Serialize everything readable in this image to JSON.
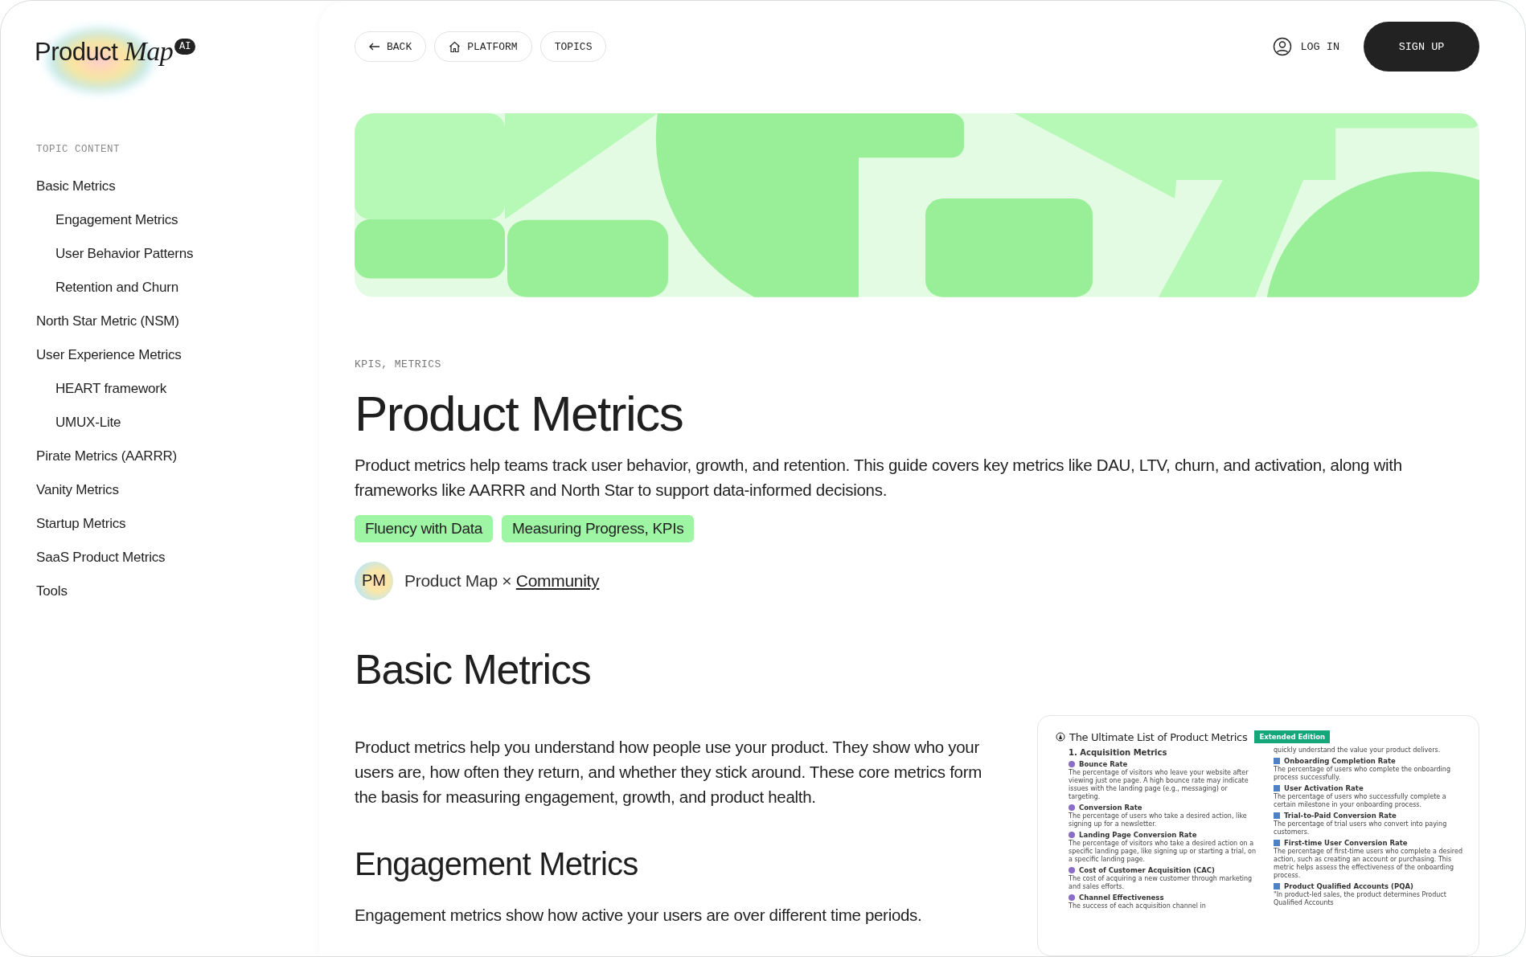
{
  "logo": {
    "text": "Product",
    "emphasis": "Map",
    "badge": "AI"
  },
  "nav": [
    {
      "label": "BACK",
      "kind": "back"
    },
    {
      "label": "PLATFORM",
      "kind": "home"
    },
    {
      "label": "TOPICS",
      "kind": "plain"
    }
  ],
  "auth": {
    "login": "LOG IN",
    "signup": "SIGN UP"
  },
  "sidebar": {
    "heading": "TOPIC CONTENT",
    "items": [
      {
        "label": "Basic Metrics",
        "children": [
          {
            "label": "Engagement Metrics"
          },
          {
            "label": "User Behavior Patterns"
          },
          {
            "label": "Retention and Churn"
          }
        ]
      },
      {
        "label": "North Star Metric (NSM)"
      },
      {
        "label": "User Experience Metrics",
        "children": [
          {
            "label": "HEART framework"
          },
          {
            "label": "UMUX-Lite"
          }
        ]
      },
      {
        "label": "Pirate Metrics (AARRR)"
      },
      {
        "label": "Vanity Metrics"
      },
      {
        "label": "Startup Metrics"
      },
      {
        "label": "SaaS Product Metrics"
      },
      {
        "label": "Tools"
      }
    ]
  },
  "article": {
    "breadcrumb": "KPIS, METRICS",
    "title": "Product Metrics",
    "intro": "Product metrics help teams track user behavior, growth, and retention. This guide covers key metrics like DAU, LTV, churn, and activation, along with frameworks like AARRR and North Star to support data-informed decisions.",
    "tags": [
      "Fluency with Data",
      "Measuring Progress, KPIs"
    ],
    "author": {
      "initials": "PM",
      "name": "Product Map ×",
      "link": "Community"
    },
    "basic": {
      "heading": "Basic Metrics",
      "paragraph": "Product metrics help you understand how people use your product. They show who your users are, how often they return, and whether they stick around. These core metrics form the basis for measuring engagement, growth, and product health."
    },
    "engagement": {
      "heading": "Engagement Metrics",
      "paragraph": "Engagement metrics show how active your users are over different time periods."
    }
  },
  "document_preview": {
    "title": "The Ultimate List of Product Metrics",
    "badge": "Extended Edition",
    "left": {
      "heading": "1. Acquisition Metrics",
      "items": [
        {
          "name": "Bounce Rate",
          "text": "The percentage of visitors who leave your website after viewing just one page. A high bounce rate may indicate issues with the landing page (e.g., messaging) or targeting."
        },
        {
          "name": "Conversion Rate",
          "text": "The percentage of users who take a desired action, like signing up for a newsletter."
        },
        {
          "name": "Landing Page Conversion Rate",
          "text": "The percentage of visitors who take a desired action on a specific landing page, like signing up or starting a trial, on a specific landing page."
        },
        {
          "name": "Cost of Customer Acquisition (CAC)",
          "text": "The cost of acquiring a new customer through marketing and sales efforts."
        },
        {
          "name": "Channel Effectiveness",
          "text": "The success of each acquisition channel in"
        }
      ]
    },
    "right": {
      "lead": "quickly understand the value your product delivers.",
      "items": [
        {
          "name": "Onboarding Completion Rate",
          "text": "The percentage of users who complete the onboarding process successfully."
        },
        {
          "name": "User Activation Rate",
          "text": "The percentage of users who successfully complete a certain milestone in your onboarding process."
        },
        {
          "name": "Trial-to-Paid Conversion Rate",
          "text": "The percentage of trial users who convert into paying customers."
        },
        {
          "name": "First-time User Conversion Rate",
          "text": "The percentage of first-time users who complete a desired action, such as creating an account or purchasing. This metric helps assess the effectiveness of the onboarding process."
        },
        {
          "name": "Product Qualified Accounts (PQA)",
          "text": "\"In product-led sales, the product determines Product Qualified Accounts"
        }
      ]
    }
  }
}
